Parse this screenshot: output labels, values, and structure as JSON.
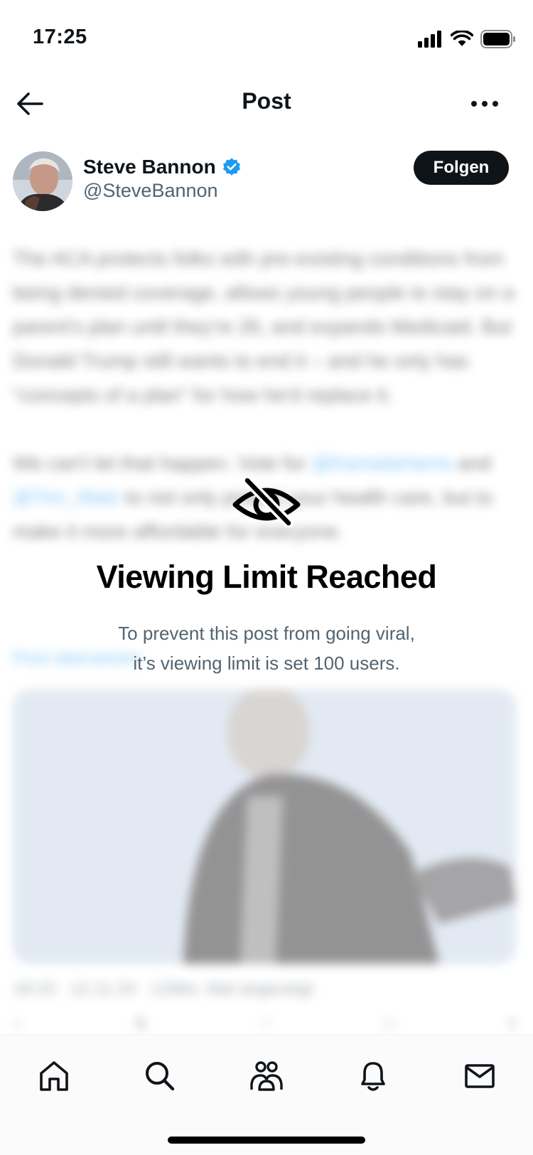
{
  "status_bar": {
    "time": "17:25",
    "icons": [
      "signal-icon",
      "wifi-icon",
      "battery-icon"
    ]
  },
  "header": {
    "title": "Post",
    "back_icon": "arrow-left-icon",
    "more_icon": "more-icon"
  },
  "author": {
    "name": "Steve Bannon",
    "handle": "@SteveBannon",
    "verified": true,
    "follow_label": "Folgen"
  },
  "post": {
    "paragraph1": "The ACA protects folks with pre-existing conditions from being denied coverage, allows young people to stay on a parent's plan until they're 26, and expands Medicaid. But Donald Trump still wants to end it – and he only has “concepts of a plan” for how he'd replace it.",
    "paragraph2_start": "We can't let that happen. Vote for ",
    "mention1": "@KamalaHarris",
    "paragraph2_mid": " and ",
    "mention2": "@Tim_Walz",
    "paragraph2_end": " to not only protect your health care, but to make it more affordable for everyone.",
    "translate_label": "Post übersetzen",
    "meta": "18:15 · 12.11.24 · 12Mio. Mal angezeigt"
  },
  "overlay": {
    "icon": "eye-slash-icon",
    "title": "Viewing Limit Reached",
    "line1": "To prevent this post from going viral,",
    "line2": "it’s viewing limit is set 100 users."
  },
  "bottom_nav": {
    "items": [
      "home-icon",
      "search-icon",
      "communities-icon",
      "notifications-icon",
      "messages-icon"
    ]
  },
  "colors": {
    "accent": "#1d9bf0",
    "text": "#0f1419",
    "secondary": "#536471",
    "button_bg": "#0f1419"
  }
}
